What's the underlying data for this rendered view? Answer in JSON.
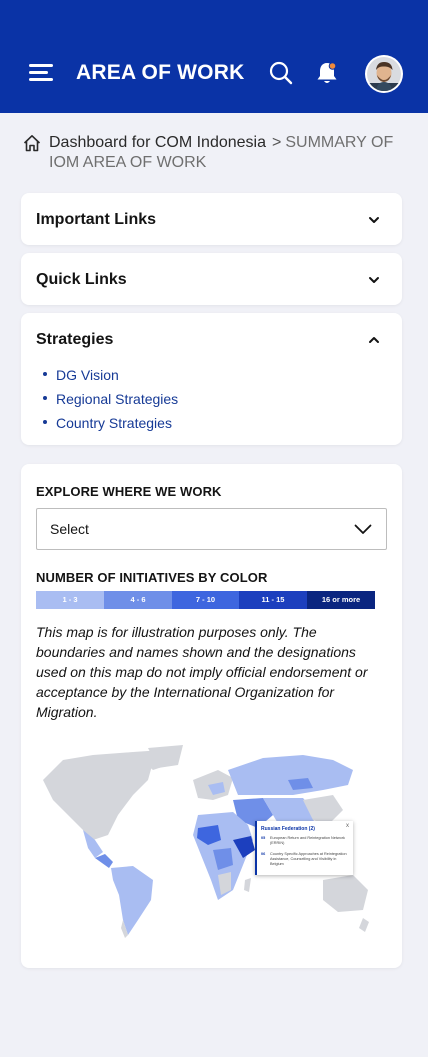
{
  "header": {
    "title": "AREA OF WORK",
    "colors": {
      "bar": "#0a33a6"
    }
  },
  "breadcrumb": {
    "parent": "Dashboard for COM Indonesia",
    "separator": ">",
    "current": "SUMMARY OF IOM AREA OF WORK"
  },
  "accordions": [
    {
      "label": "Important Links",
      "expanded": false
    },
    {
      "label": "Quick Links",
      "expanded": false
    },
    {
      "label": "Strategies",
      "expanded": true,
      "items": [
        "DG Vision",
        "Regional Strategies",
        "Country Strategies"
      ]
    }
  ],
  "explore": {
    "label": "EXPLORE WHERE WE WORK",
    "select_value": "Select"
  },
  "legend": {
    "label": "NUMBER OF INITIATIVES BY COLOR",
    "bins": [
      {
        "range": "1 - 3",
        "color": "#a9bdf2"
      },
      {
        "range": "4 - 6",
        "color": "#6f8fe8"
      },
      {
        "range": "7 - 10",
        "color": "#3e66df"
      },
      {
        "range": "11 - 15",
        "color": "#1c3fbe"
      },
      {
        "range": "16 or more",
        "color": "#0a2580"
      }
    ]
  },
  "disclaimer": "This map is for illustration purposes only. The boundaries and names shown and the designations used on this map do not imply official endorsement or acceptance by the International Organization for Migration.",
  "map_popup": {
    "title": "Russian Federation (2)",
    "close": "x",
    "rows": [
      {
        "num": "05",
        "text": "European Return and Reintegration Network (ERRIN)"
      },
      {
        "num": "06",
        "text": "Country Specific Approaches at Reintegration Assistance, Counselling and Visibility in Belgium"
      }
    ]
  }
}
